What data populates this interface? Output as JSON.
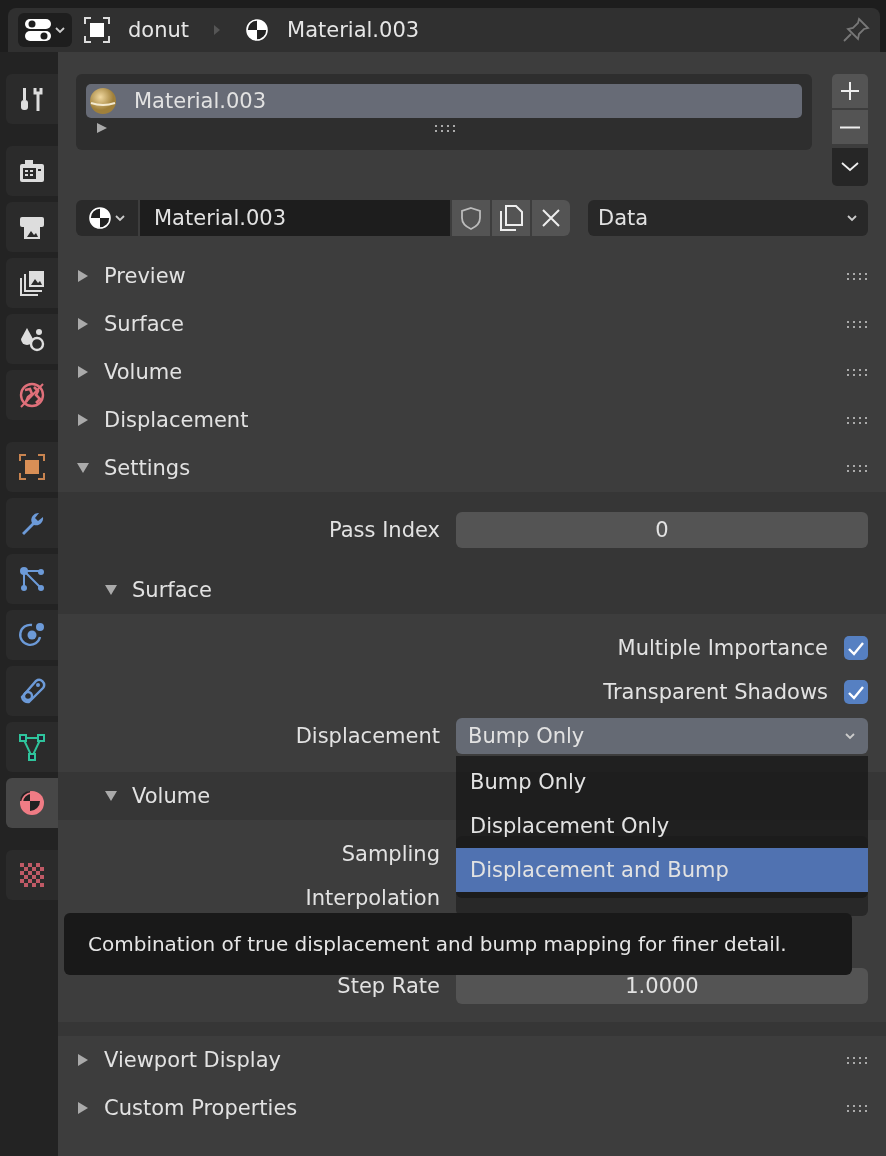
{
  "header": {
    "breadcrumb": [
      {
        "kind": "object",
        "text": "donut"
      },
      {
        "kind": "material",
        "text": "Material.003"
      }
    ],
    "pinned": false
  },
  "sidebar": {
    "groups": [
      [
        {
          "kind": "tool",
          "selected": false
        }
      ],
      [
        {
          "kind": "render",
          "selected": false
        },
        {
          "kind": "output",
          "selected": false
        },
        {
          "kind": "view_layer",
          "selected": false
        },
        {
          "kind": "scene",
          "selected": false
        },
        {
          "kind": "world",
          "selected": false
        }
      ],
      [
        {
          "kind": "object",
          "selected": false
        },
        {
          "kind": "modifier",
          "selected": false
        },
        {
          "kind": "particles",
          "selected": false
        },
        {
          "kind": "physics",
          "selected": false
        },
        {
          "kind": "constraints",
          "selected": false
        },
        {
          "kind": "mesh",
          "selected": false
        },
        {
          "kind": "material",
          "selected": true
        }
      ],
      [
        {
          "kind": "texture",
          "selected": false
        }
      ]
    ]
  },
  "material_slots": {
    "items": [
      {
        "name": "Material.003",
        "selected": true
      }
    ]
  },
  "material_selector": {
    "name": "Material.003",
    "link": "Data"
  },
  "panels": [
    {
      "title": "Preview",
      "expanded": false
    },
    {
      "title": "Surface",
      "expanded": false
    },
    {
      "title": "Volume",
      "expanded": false
    },
    {
      "title": "Displacement",
      "expanded": false
    },
    {
      "title": "Settings",
      "expanded": true,
      "rows": [
        {
          "kind": "number",
          "label": "Pass Index",
          "value": "0"
        }
      ],
      "subpanels": [
        {
          "title": "Surface",
          "expanded": true,
          "rows": [
            {
              "kind": "checkbox",
              "label": "Multiple Importance",
              "checked": true
            },
            {
              "kind": "checkbox",
              "label": "Transparent Shadows",
              "checked": true
            },
            {
              "kind": "dropdown",
              "label": "Displacement",
              "value": "Bump Only",
              "open": true
            }
          ]
        },
        {
          "title": "Volume",
          "expanded": true,
          "rows": [
            {
              "kind": "dropdown",
              "label": "Sampling",
              "open": false
            },
            {
              "kind": "dropdown",
              "label": "Interpolation",
              "open": false
            },
            {
              "kind": "number",
              "label": "Step Rate",
              "value": "1.0000"
            }
          ]
        }
      ]
    },
    {
      "title": "Viewport Display",
      "expanded": false
    },
    {
      "title": "Custom Properties",
      "expanded": false
    }
  ],
  "dropdown_menu": {
    "options": [
      {
        "label": "Bump Only",
        "selected": false
      },
      {
        "label": "Displacement Only",
        "selected": false
      },
      {
        "label": "Displacement and Bump",
        "selected": true
      }
    ]
  },
  "tooltip": {
    "text": "Combination of true displacement and bump mapping for finer detail."
  }
}
